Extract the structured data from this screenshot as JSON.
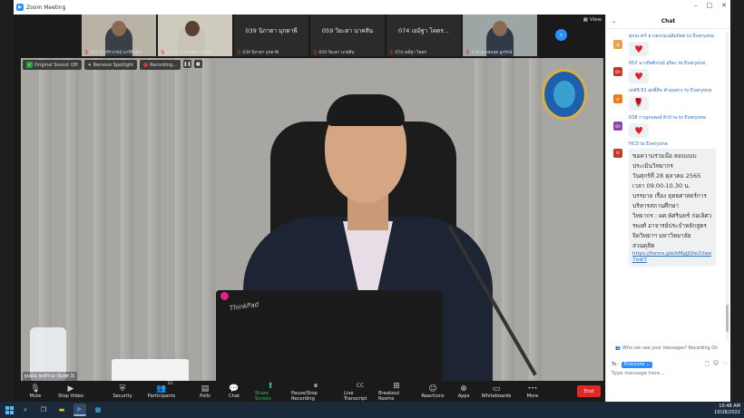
{
  "window": {
    "title": "Zoom Meeting",
    "controls": [
      "–",
      "□",
      "✕"
    ]
  },
  "thumbnails": [
    {
      "label": "078 นางจิราภรณ์ นาร์ทิพส์เร",
      "overlay": ""
    },
    {
      "label": "031 นางวรวรรณ วงศ์พิธ์",
      "overlay": ""
    },
    {
      "label": "039 นิภาดา มุกดาพี",
      "overlay": "039 นิภาดา มุกดาพี"
    },
    {
      "label": "059 วิยะดา นาคสิน",
      "overlay": "059 วิยะดา นาคสิน"
    },
    {
      "label": "074 เอมิฐา โคตร",
      "overlay": "074 เอมิฐา โคตร..."
    },
    {
      "label": "078 นายสมชุด ผูกรักษ์",
      "overlay": ""
    }
  ],
  "view_label": "View",
  "pills": {
    "original_sound": "Original Sound: Off",
    "remove_spotlight": "Remove Spotlight",
    "recording": "Recording..."
  },
  "laptop_brand": "ThinkPad",
  "speaker_label": "ฐนนัณ พงษ์ร่วม (นิเทศ 3)",
  "toolbar": {
    "items": [
      {
        "label": "Mute",
        "icon": "mic-icon",
        "glyph": "🎙"
      },
      {
        "label": "Stop Video",
        "icon": "video-icon",
        "glyph": "▶"
      },
      {
        "label": "Security",
        "icon": "shield-icon",
        "glyph": "⛨"
      },
      {
        "label": "Participants",
        "icon": "participants-icon",
        "glyph": "👥",
        "count": "83"
      },
      {
        "label": "Polls",
        "icon": "polls-icon",
        "glyph": "▤"
      },
      {
        "label": "Chat",
        "icon": "chat-icon",
        "glyph": "💬"
      },
      {
        "label": "Share Screen",
        "icon": "share-screen-icon",
        "glyph": "⬆"
      },
      {
        "label": "Pause/Stop Recording",
        "icon": "pause-icon",
        "glyph": "⏸"
      },
      {
        "label": "Live Transcript",
        "icon": "cc-icon",
        "glyph": "CC"
      },
      {
        "label": "Breakout Rooms",
        "icon": "breakout-icon",
        "glyph": "⊞"
      },
      {
        "label": "Reactions",
        "icon": "reactions-icon",
        "glyph": "☺"
      },
      {
        "label": "Apps",
        "icon": "apps-icon",
        "glyph": "⊕"
      },
      {
        "label": "Whiteboards",
        "icon": "whiteboard-icon",
        "glyph": "▭"
      },
      {
        "label": "More",
        "icon": "more-icon",
        "glyph": "•••"
      }
    ],
    "end_label": "End"
  },
  "chat": {
    "title": "Chat",
    "messages": [
      {
        "sender": "ศุภณาทร์ ยางธรรมเฉลิมกิตต",
        "to": "to Everyone",
        "avatar": "ศ",
        "avatar_color": "#e8a24a",
        "content": "heart"
      },
      {
        "sender": "052 นางกิตติภรณ์ สุริยะ",
        "to": "to Everyone",
        "avatar": "0ก",
        "avatar_color": "#c0392b",
        "content": "heart"
      },
      {
        "sender": "เตช์ชิ 61 สุทธิ์สิด ต่ำสุนทรร",
        "to": "to Everyone",
        "avatar": "ต",
        "avatar_color": "#e67e22",
        "content": "rose"
      },
      {
        "sender": "038 กาญจนพงษ์ ผิวบ้าน",
        "to": "to Everyone",
        "avatar": "0ก",
        "avatar_color": "#8e44ad",
        "content": "heart"
      }
    ],
    "long_message": {
      "sender": "HCD",
      "to": "to Everyone",
      "avatar": "H",
      "avatar_color": "#c0392b",
      "lines": [
        "ขอความร่วมมือ ตอบแบบประเมินวิทยากร",
        "วันศุกร์ที่ 28 ตุลาคม 2565 เวลา 09.00-10.30 น.",
        "บรรยาย เรื่อง ยุทธศาสตร์การบริหารสถานศึกษา",
        "วิทยากร : ผศ.พัศรินทร์ ก่อเลิศวรพงศ์ อาจารย์ประจำหลักสูตรจิตวิทยาฯ มหาวิทยาลัยสวนดุสิต"
      ],
      "link": "https://forms.gle/kMpJJQte2Vwe7mK7"
    },
    "who_can_see": "Who can see your messages? Recording On",
    "to_label": "To:",
    "recipient": "Everyone",
    "input_placeholder": "Type message here..."
  },
  "taskbar": {
    "time": "10:48 AM",
    "date": "10/28/2022"
  }
}
